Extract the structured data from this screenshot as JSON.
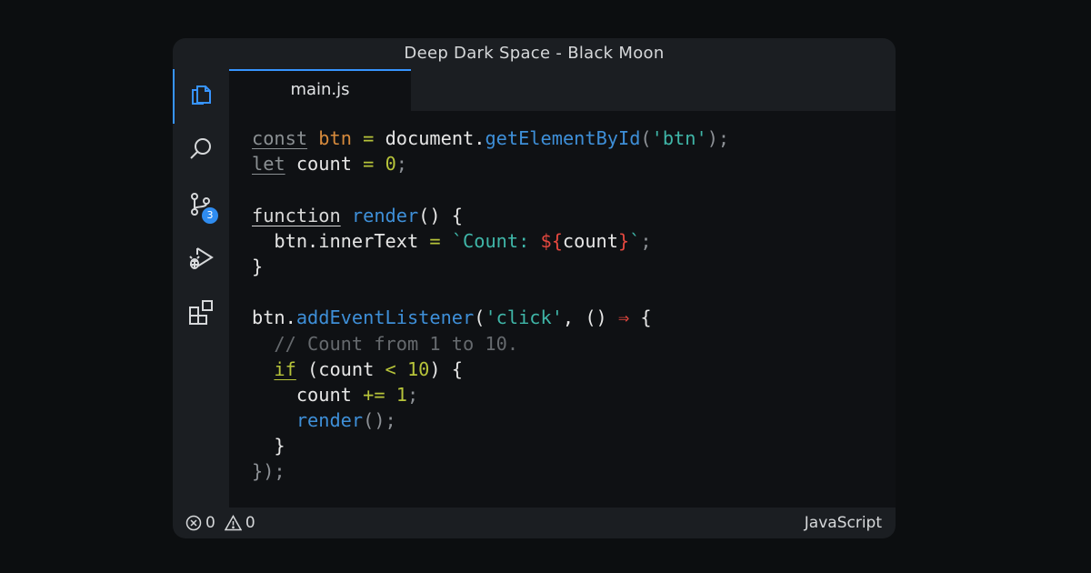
{
  "window": {
    "title": "Deep Dark Space - Black Moon"
  },
  "activity_bar": {
    "items": [
      {
        "icon": "files-icon",
        "active": true
      },
      {
        "icon": "search-icon"
      },
      {
        "icon": "source-control-icon",
        "badge": "3"
      },
      {
        "icon": "run-debug-icon"
      },
      {
        "icon": "extensions-icon"
      }
    ],
    "accent_color": "#3794ff"
  },
  "tabs": [
    {
      "label": "main.js",
      "active": true
    }
  ],
  "editor": {
    "language": "JavaScript",
    "lines": [
      [
        {
          "t": "const",
          "c": "kw"
        },
        {
          "t": " "
        },
        {
          "t": "btn",
          "c": "var"
        },
        {
          "t": " "
        },
        {
          "t": "=",
          "c": "op"
        },
        {
          "t": " document."
        },
        {
          "t": "getElementById",
          "c": "fn"
        },
        {
          "t": "(",
          "c": "punc"
        },
        {
          "t": "'btn'",
          "c": "str"
        },
        {
          "t": ");",
          "c": "punc"
        }
      ],
      [
        {
          "t": "let",
          "c": "kw"
        },
        {
          "t": " count "
        },
        {
          "t": "=",
          "c": "op"
        },
        {
          "t": " "
        },
        {
          "t": "0",
          "c": "num"
        },
        {
          "t": ";",
          "c": "punc"
        }
      ],
      [],
      [
        {
          "t": "function",
          "c": "kwf"
        },
        {
          "t": " "
        },
        {
          "t": "render",
          "c": "fn"
        },
        {
          "t": "() {"
        }
      ],
      [
        {
          "t": "  btn.innerText "
        },
        {
          "t": "=",
          "c": "op"
        },
        {
          "t": " "
        },
        {
          "t": "`Count: ",
          "c": "str"
        },
        {
          "t": "${",
          "c": "tpl"
        },
        {
          "t": "count"
        },
        {
          "t": "}",
          "c": "tpl"
        },
        {
          "t": "`",
          "c": "str"
        },
        {
          "t": ";",
          "c": "punc"
        }
      ],
      [
        {
          "t": "}"
        }
      ],
      [],
      [
        {
          "t": "btn."
        },
        {
          "t": "addEventListener",
          "c": "fn"
        },
        {
          "t": "("
        },
        {
          "t": "'click'",
          "c": "str"
        },
        {
          "t": ", () "
        },
        {
          "t": "⇒",
          "c": "tpl"
        },
        {
          "t": " {"
        }
      ],
      [
        {
          "t": "  "
        },
        {
          "t": "// Count from 1 to 10.",
          "c": "cmt"
        }
      ],
      [
        {
          "t": "  "
        },
        {
          "t": "if",
          "c": "kwif"
        },
        {
          "t": " (count "
        },
        {
          "t": "<",
          "c": "op"
        },
        {
          "t": " "
        },
        {
          "t": "10",
          "c": "num"
        },
        {
          "t": ") {"
        }
      ],
      [
        {
          "t": "    count "
        },
        {
          "t": "+=",
          "c": "op"
        },
        {
          "t": " "
        },
        {
          "t": "1",
          "c": "num"
        },
        {
          "t": ";",
          "c": "punc"
        }
      ],
      [
        {
          "t": "    "
        },
        {
          "t": "render",
          "c": "fn"
        },
        {
          "t": "();",
          "c": "punc"
        }
      ],
      [
        {
          "t": "  }"
        }
      ],
      [
        {
          "t": "});",
          "c": "punc"
        }
      ]
    ]
  },
  "status_bar": {
    "errors": "0",
    "warnings": "0",
    "language": "JavaScript"
  }
}
